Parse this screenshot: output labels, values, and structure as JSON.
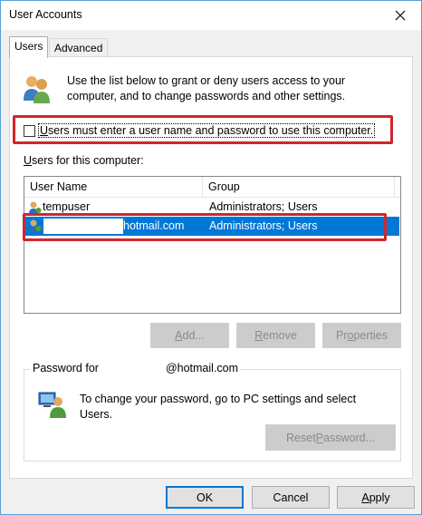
{
  "window": {
    "title": "User Accounts",
    "accent_color": "#0078d7",
    "highlight_color": "#d0262d"
  },
  "tabs": [
    {
      "label": "Users",
      "active": true
    },
    {
      "label": "Advanced",
      "active": false
    }
  ],
  "users_tab": {
    "intro_text": "Use the list below to grant or deny users access to your computer, and to change passwords and other settings.",
    "require_login_checkbox": {
      "label_first": "U",
      "label_rest": "sers must enter a user name and password to use this computer.",
      "checked": false
    },
    "users_list_label_first": "U",
    "users_list_label_rest": "sers for this computer:",
    "columns": [
      "User Name",
      "Group"
    ],
    "rows": [
      {
        "name": "tempuser",
        "group": "Administrators; Users",
        "selected": false
      },
      {
        "name": "hotmail.com",
        "group": "Administrators; Users",
        "selected": true
      }
    ],
    "buttons": {
      "add": {
        "first": "A",
        "rest": "dd..."
      },
      "remove": {
        "first": "R",
        "rest": "emove"
      },
      "properties": {
        "first": "Pr",
        "mid": "o",
        "rest": "perties"
      }
    },
    "password_group": {
      "legend_prefix": "Password for",
      "legend_suffix": "@hotmail.com",
      "text": "To change your password, go to PC settings and select Users.",
      "reset_button": {
        "first": "Reset ",
        "mid": "P",
        "rest": "assword..."
      }
    }
  },
  "dialog_buttons": {
    "ok": "OK",
    "cancel": "Cancel",
    "apply_first": "A",
    "apply_rest": "pply"
  },
  "icons": [
    "users-icon",
    "user-row-icon",
    "password-icon",
    "close-icon"
  ]
}
